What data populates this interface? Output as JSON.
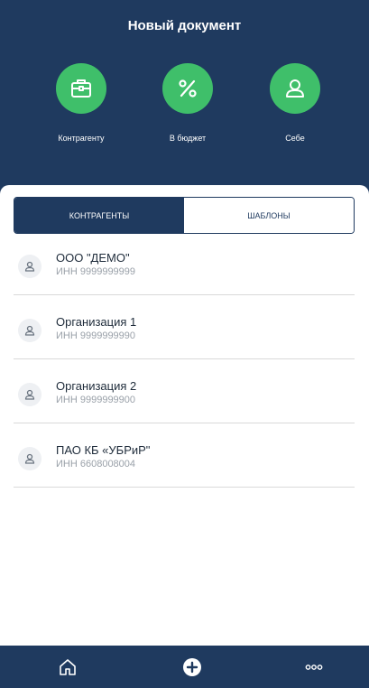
{
  "header": {
    "title": "Новый документ",
    "actions": [
      {
        "label": "Контрагенту",
        "icon": "briefcase-icon"
      },
      {
        "label": "В бюджет",
        "icon": "percent-icon"
      },
      {
        "label": "Себе",
        "icon": "person-icon"
      }
    ]
  },
  "tabs": [
    {
      "label": "КОНТРАГЕНТЫ",
      "active": true
    },
    {
      "label": "ШАБЛОНЫ",
      "active": false
    }
  ],
  "contractors": [
    {
      "name": "ООО \"ДЕМО\"",
      "inn": "ИНН 9999999999"
    },
    {
      "name": "Организация 1",
      "inn": "ИНН 9999999990"
    },
    {
      "name": "Организация 2",
      "inn": "ИНН 9999999900"
    },
    {
      "name": "ПАО КБ «УБРиР\"",
      "inn": "ИНН 6608008004"
    }
  ],
  "bottom_nav": [
    {
      "icon": "home-icon"
    },
    {
      "icon": "plus-circle-icon"
    },
    {
      "icon": "more-icon"
    }
  ],
  "colors": {
    "primary": "#1f3a5f",
    "accent_green": "#3fbf6a"
  }
}
